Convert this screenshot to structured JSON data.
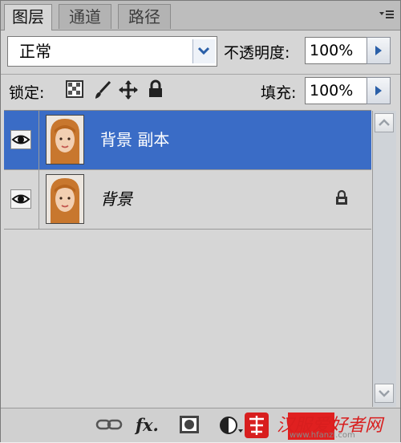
{
  "tabs": [
    {
      "label": "图层",
      "active": true
    },
    {
      "label": "通道",
      "active": false
    },
    {
      "label": "路径",
      "active": false
    }
  ],
  "panel_menu_icon": "panel-menu-icon",
  "blend_mode": {
    "value": "正常"
  },
  "opacity": {
    "label": "不透明度:",
    "value": "100%"
  },
  "lock": {
    "label": "锁定:",
    "icons": [
      "lock-transparent-icon",
      "lock-paint-icon",
      "lock-position-icon",
      "lock-all-icon"
    ]
  },
  "fill": {
    "label": "填充:",
    "value": "100%"
  },
  "layers": [
    {
      "name": "背景 副本",
      "selected": true,
      "visible": true,
      "locked": false
    },
    {
      "name": "背景",
      "selected": false,
      "visible": true,
      "locked": true,
      "italic": true
    }
  ],
  "bottom_tools": [
    "link-layers-icon",
    "fx-icon",
    "mask-icon",
    "adjustment-layer-icon",
    "new-group-icon",
    "new-layer-icon",
    "delete-layer-icon"
  ],
  "fx_label": "fx.",
  "watermark": {
    "text": "汉服爱好者网",
    "url": "www.hfanzi.com"
  },
  "colors": {
    "selection": "#3a6cc6",
    "panel": "#d6d6d6",
    "watermark": "#d81e1e"
  }
}
